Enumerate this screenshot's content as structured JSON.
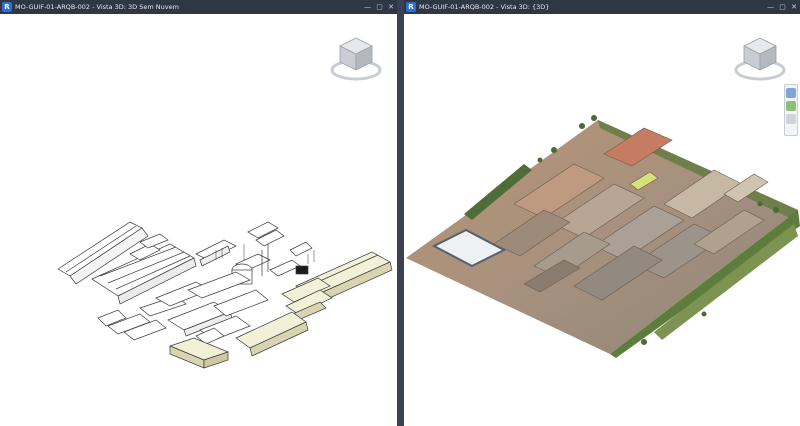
{
  "left_view": {
    "title": "MO-GUIF-01-ARQB-002 - Vista 3D: 3D Sem Nuvem",
    "app_icon": "R",
    "controls": {
      "minimize": "—",
      "restore": "▢",
      "close": "✕"
    }
  },
  "right_view": {
    "title": "MO-GUIF-01-ARQB-002 - Vista 3D: {3D}",
    "app_icon": "R",
    "controls": {
      "minimize": "—",
      "restore": "▢",
      "close": "✕"
    }
  },
  "icons": {
    "app": "revit-app-icon",
    "viewcube": "viewcube-icon",
    "steering_wheel": "steering-wheel-icon",
    "zoom": "zoom-icon"
  },
  "colors": {
    "title_bar": "#2f3644",
    "app_icon": "#2d6fd3",
    "model_line": "#3a3a3a",
    "model_fill": "#f3f0d8",
    "terrain": "#a88a6e",
    "vegetation": "#5e7d3d"
  }
}
